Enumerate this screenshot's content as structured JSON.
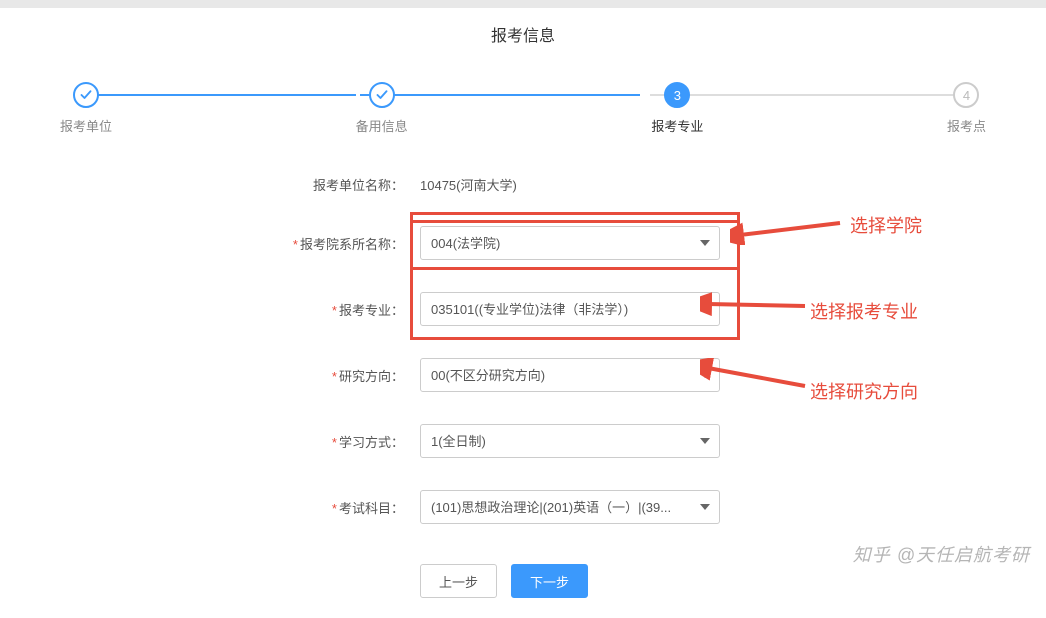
{
  "page_title": "报考信息",
  "stepper": {
    "steps": [
      {
        "label": "报考单位",
        "state": "done"
      },
      {
        "label": "备用信息",
        "state": "done"
      },
      {
        "label": "报考专业",
        "state": "current",
        "num": "3"
      },
      {
        "label": "报考点",
        "state": "future",
        "num": "4"
      }
    ]
  },
  "form": {
    "unit_name": {
      "label": "报考单位名称：",
      "value": "10475(河南大学)"
    },
    "dept": {
      "label": "报考院系所名称：",
      "value": "004(法学院)"
    },
    "major": {
      "label": "报考专业：",
      "value": "035101((专业学位)法律（非法学）)"
    },
    "direction": {
      "label": "研究方向：",
      "value": "00(不区分研究方向)"
    },
    "mode": {
      "label": "学习方式：",
      "value": "1(全日制)"
    },
    "subjects": {
      "label": "考试科目：",
      "value": "(101)思想政治理论|(201)英语（一）|(39..."
    }
  },
  "buttons": {
    "prev": "上一步",
    "next": "下一步"
  },
  "annotations": {
    "a1": "选择学院",
    "a2": "选择报考专业",
    "a3": "选择研究方向"
  },
  "watermark": "知乎 @天任启航考研",
  "colors": {
    "accent": "#3b99fc",
    "highlight": "#e74c3c"
  }
}
